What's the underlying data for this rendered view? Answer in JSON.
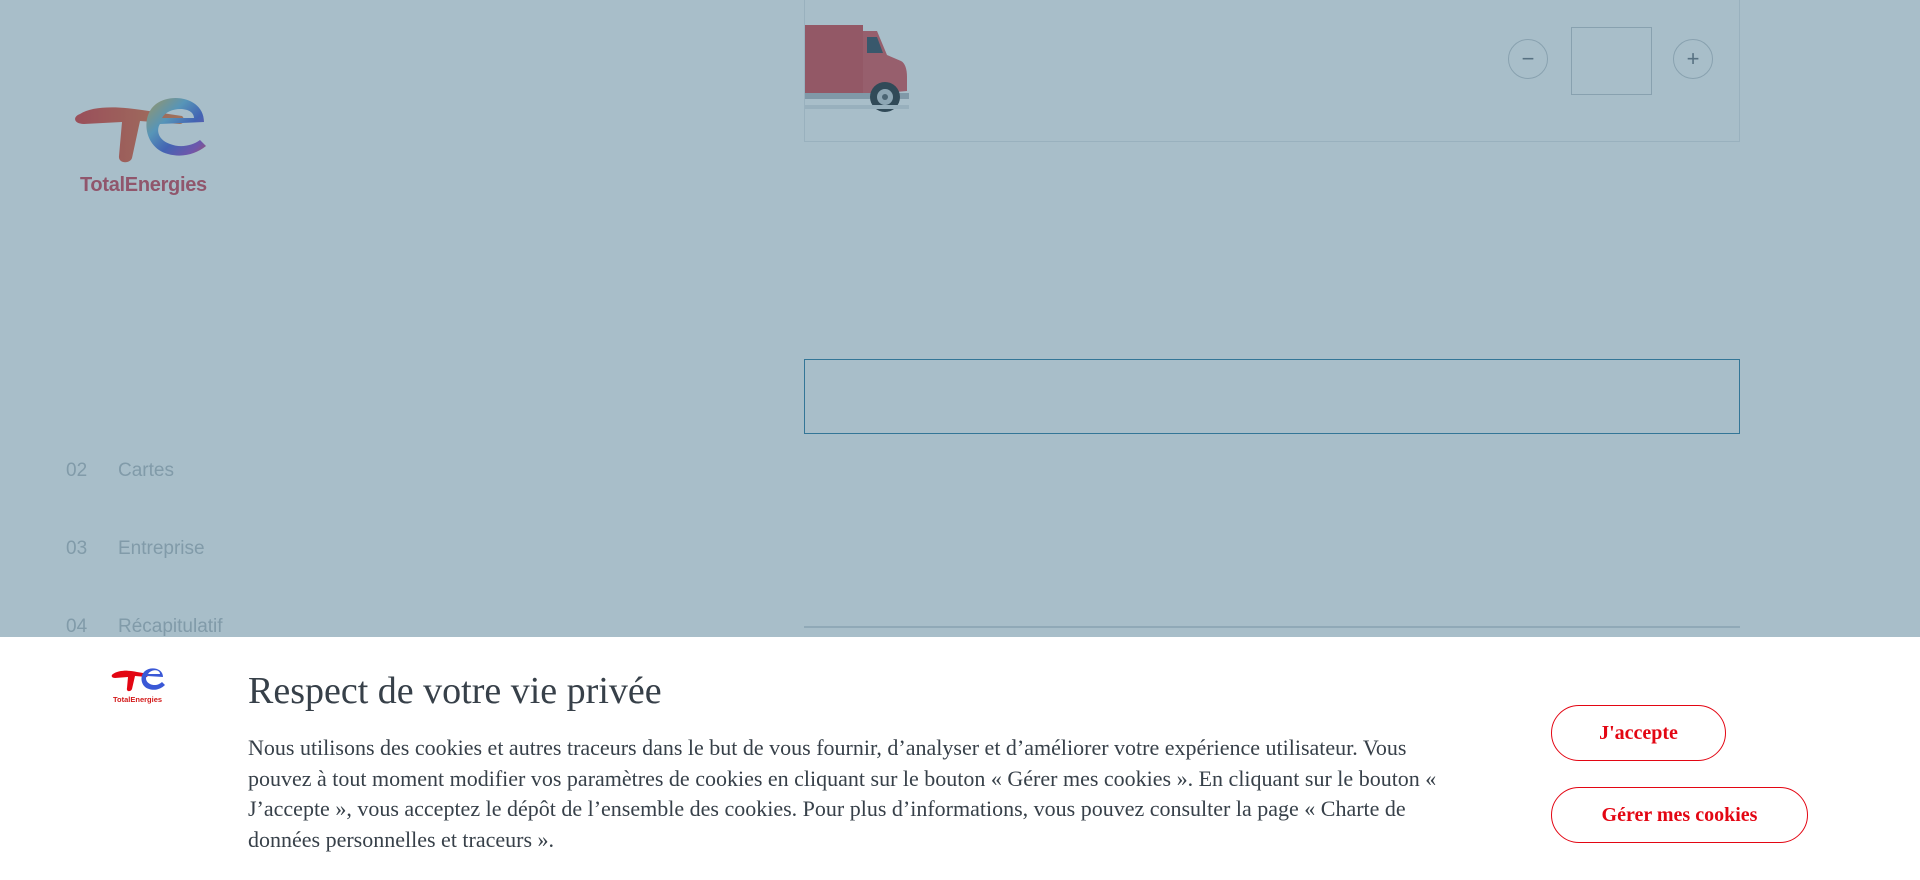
{
  "brand": {
    "name": "TotalEnergies",
    "logo_icon": "totalenergies-logo",
    "primary_color": "#e30613"
  },
  "sidebar": {
    "steps": [
      {
        "number": "02",
        "label": "Cartes"
      },
      {
        "number": "03",
        "label": "Entreprise"
      },
      {
        "number": "04",
        "label": "Récapitulatif"
      }
    ]
  },
  "product": {
    "image_icon": "truck-icon",
    "minus_icon": "minus-icon",
    "plus_icon": "plus-icon",
    "quantity_value": ""
  },
  "form": {
    "text_field_value": ""
  },
  "cookie_banner": {
    "title": "Respect de votre vie privée",
    "text": "Nous utilisons des cookies et autres traceurs dans le but de vous fournir, d’analyser et d’améliorer votre expérience utilisateur. Vous pouvez à tout moment modifier vos paramètres de cookies en cliquant sur le bouton « Gérer mes cookies ». En cliquant sur le bouton « J’accepte », vous acceptez le dépôt de l’ensemble des cookies. Pour plus d’informations, vous pouvez consulter la page « Charte de données personnelles et traceurs ».",
    "accept_label": "J'accepte",
    "manage_label": "Gérer mes cookies"
  }
}
